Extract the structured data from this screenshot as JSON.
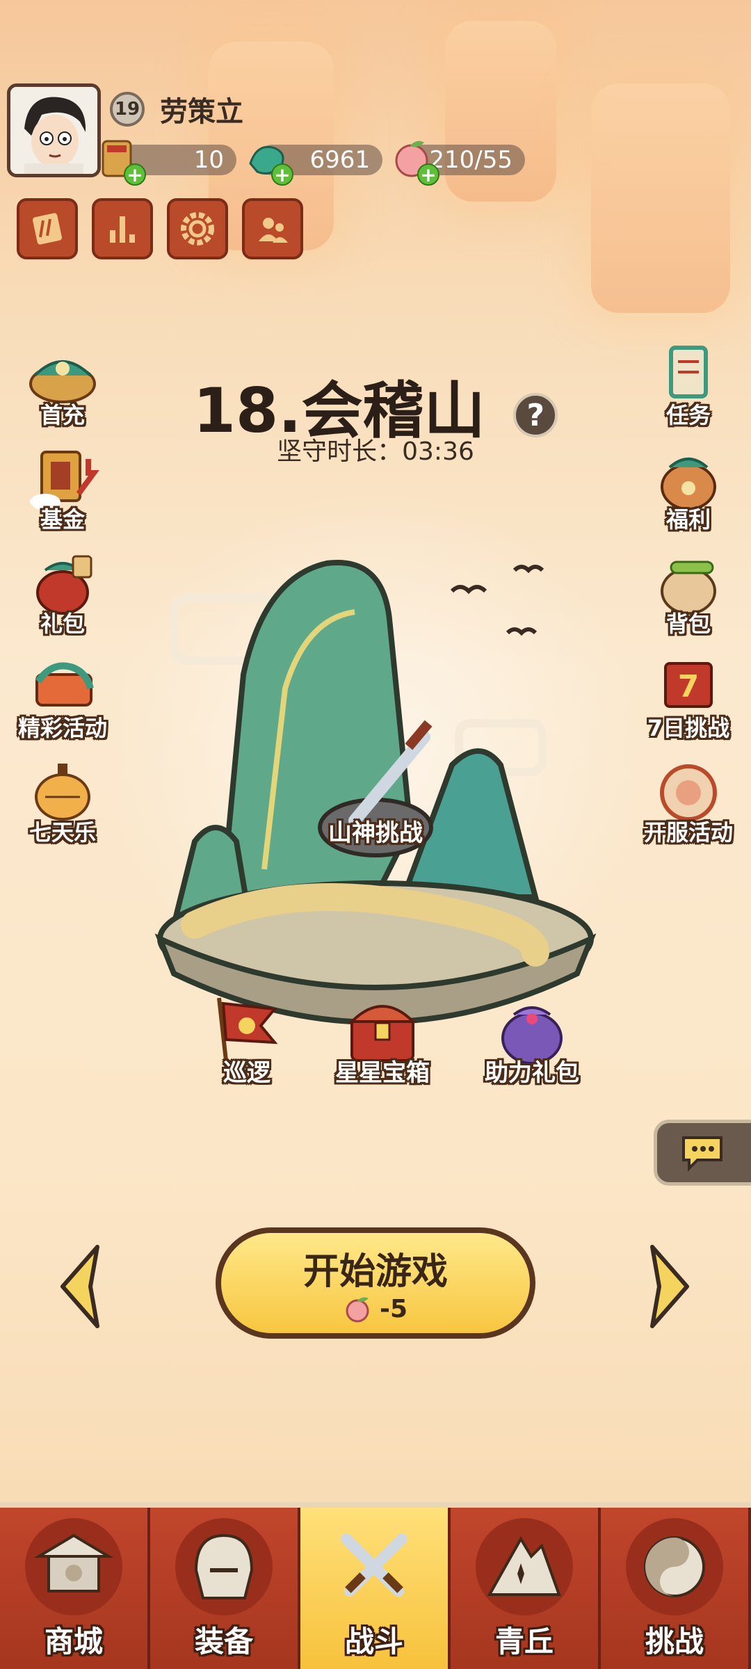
{
  "player": {
    "name": "劳策立",
    "level": "19"
  },
  "resources": [
    {
      "name": "scroll",
      "value": "10"
    },
    {
      "name": "jade",
      "value": "6961"
    },
    {
      "name": "peach-stamina",
      "value": "210/55"
    }
  ],
  "top_buttons": [
    "ticket-icon",
    "ranking-icon",
    "settings-icon",
    "friends-icon"
  ],
  "left_menu": [
    {
      "label": "首充"
    },
    {
      "label": "基金"
    },
    {
      "label": "礼包"
    },
    {
      "label": "精彩活动"
    },
    {
      "label": "七天乐"
    }
  ],
  "right_menu": [
    {
      "label": "任务"
    },
    {
      "label": "福利"
    },
    {
      "label": "背包"
    },
    {
      "label": "7日挑战"
    },
    {
      "label": "开服活动"
    }
  ],
  "stage": {
    "title": "18.会稽山",
    "guard_time": "坚守时长：03:36",
    "challenge_label": "山神挑战"
  },
  "stage_actions": [
    {
      "label": "巡逻"
    },
    {
      "label": "星星宝箱"
    },
    {
      "label": "助力礼包"
    }
  ],
  "start": {
    "label": "开始游戏",
    "cost": "-5"
  },
  "bottom_nav": [
    {
      "label": "商城",
      "active": false
    },
    {
      "label": "装备",
      "active": false
    },
    {
      "label": "战斗",
      "active": true
    },
    {
      "label": "青丘",
      "active": false
    },
    {
      "label": "挑战",
      "active": false
    }
  ],
  "colors": {
    "accent": "#f7c640",
    "nav": "#a6361f",
    "text_dark": "#2b1f18"
  }
}
